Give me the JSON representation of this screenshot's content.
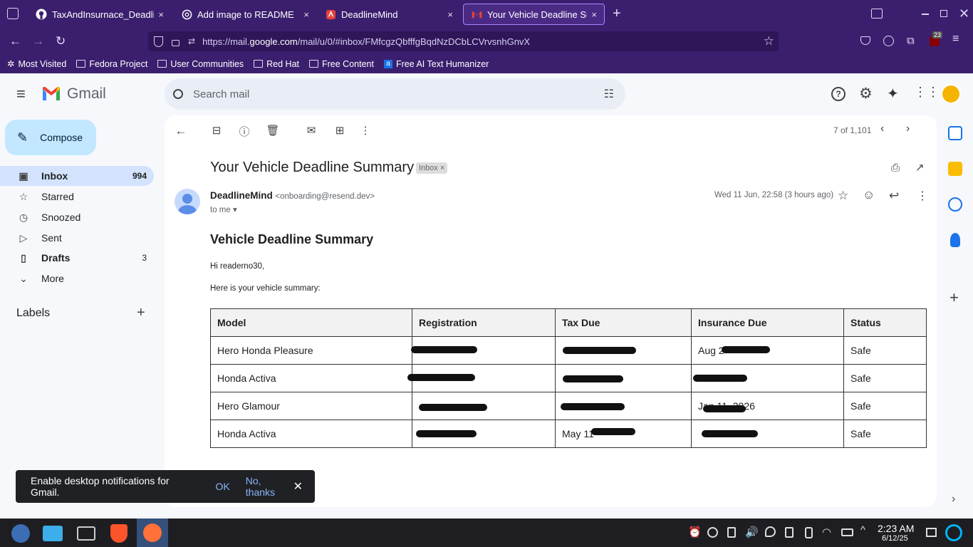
{
  "browser": {
    "tabs": [
      {
        "title": "TaxAndInsurnace_Deadline",
        "icon": "github-icon"
      },
      {
        "title": "Add image to README",
        "icon": "openai-icon"
      },
      {
        "title": "DeadlineMind",
        "icon": "deadlinemind-icon"
      },
      {
        "title": "Your Vehicle Deadline Summ",
        "icon": "gmail-icon"
      }
    ],
    "close_glyph": "×",
    "new_tab_glyph": "+",
    "url_prefix": "https://mail.",
    "url_domain": "google.com",
    "url_path": "/mail/u/0/#inbox/FMfcgzQbfffgBqdNzDCbLCVrvsnhGnvX",
    "extension_badge": "23",
    "bookmarks": [
      "Most Visited",
      "Fedora Project",
      "User Communities",
      "Red Hat",
      "Free Content",
      "Free AI Text Humanizer"
    ]
  },
  "gmail": {
    "app_name": "Gmail",
    "search_placeholder": "Search mail",
    "compose_label": "Compose",
    "nav": [
      {
        "label": "Inbox",
        "count": "994",
        "icon": "inbox-icon"
      },
      {
        "label": "Starred",
        "count": "",
        "icon": "star-icon"
      },
      {
        "label": "Snoozed",
        "count": "",
        "icon": "clock-icon"
      },
      {
        "label": "Sent",
        "count": "",
        "icon": "send-icon"
      },
      {
        "label": "Drafts",
        "count": "3",
        "icon": "draft-icon"
      },
      {
        "label": "More",
        "count": "",
        "icon": "chevron-down-icon"
      }
    ],
    "labels_heading": "Labels",
    "pagination": "7 of 1,101"
  },
  "email": {
    "subject": "Your Vehicle Deadline Summary",
    "label_badge": "Inbox",
    "sender_name": "DeadlineMind",
    "sender_email": "<onboarding@resend.dev>",
    "recipient": "to me",
    "date": "Wed 11 Jun, 22:58 (3 hours ago)",
    "body_heading": "Vehicle Deadline Summary",
    "greeting": "Hi readerno30,",
    "intro": "Here is your vehicle summary:",
    "table": {
      "headers": [
        "Model",
        "Registration",
        "Tax Due",
        "Insurance Due",
        "Status"
      ],
      "rows": [
        [
          "Hero Honda Pleasure",
          "",
          "",
          "Aug 2",
          "Safe"
        ],
        [
          "Honda Activa",
          "",
          "",
          "",
          "Safe"
        ],
        [
          "Hero Glamour",
          "",
          "",
          "Jan 11, 2026",
          "Safe"
        ],
        [
          "Honda Activa",
          "",
          "May 11",
          "",
          "Safe"
        ]
      ]
    }
  },
  "snackbar": {
    "message": "Enable desktop notifications for Gmail.",
    "ok": "OK",
    "dismiss": "No, thanks"
  },
  "taskbar": {
    "time": "2:23 AM",
    "date": "6/12/25"
  },
  "colors": {
    "firefox_purple": "#3b1f6e",
    "gmail_bg": "#f6f8fc",
    "compose_bg": "#c2e7ff",
    "selected_nav": "#d3e3fd",
    "link_blue": "#8ab4f8"
  }
}
